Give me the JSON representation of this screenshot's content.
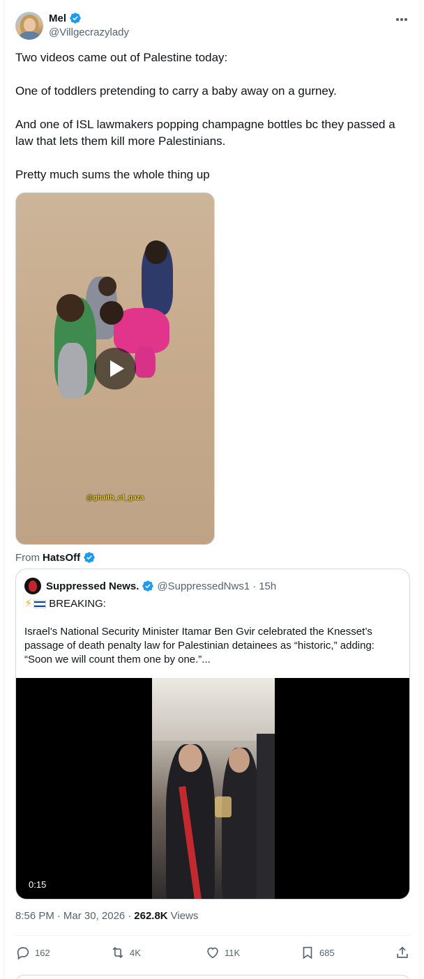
{
  "post": {
    "author": {
      "display_name": "Mel",
      "handle": "@Villgecrazylady",
      "verified": true
    },
    "text_paragraphs": [
      "Two videos came out of Palestine today:",
      "One of toddlers pretending to carry a baby away on a gurney.",
      "And one of ISL lawmakers popping champagne bottles bc they passed a law that lets them kill more Palestinians.",
      "Pretty much sums the whole thing up"
    ],
    "media": {
      "watermark": "@ghaith_of_gaza"
    },
    "from": {
      "label": "From",
      "name": "HatsOff"
    },
    "quote": {
      "author_name": "Suppressed News.",
      "handle": "@SuppressedNws1",
      "separator": "·",
      "time": "15h",
      "headline": "BREAKING:",
      "text": "Israel’s National Security Minister Itamar Ben Gvir celebrated the Knesset’s passage of death penalty law for Palestinian detainees as “historic,” adding: “Soon we will count them one by one.”...",
      "video_duration": "0:15"
    },
    "timestamp": {
      "time": "8:56 PM",
      "separator": "·",
      "date": "Mar 30, 2026",
      "separator2": "·",
      "views_count": "262.8K",
      "views_label": "Views"
    },
    "actions": {
      "replies": "162",
      "reposts": "4K",
      "likes": "11K",
      "bookmarks": "685"
    }
  },
  "colors": {
    "text_primary": "#0f1419",
    "text_secondary": "#536471",
    "verified_blue": "#1d9bf0",
    "border": "#cfd9de"
  }
}
